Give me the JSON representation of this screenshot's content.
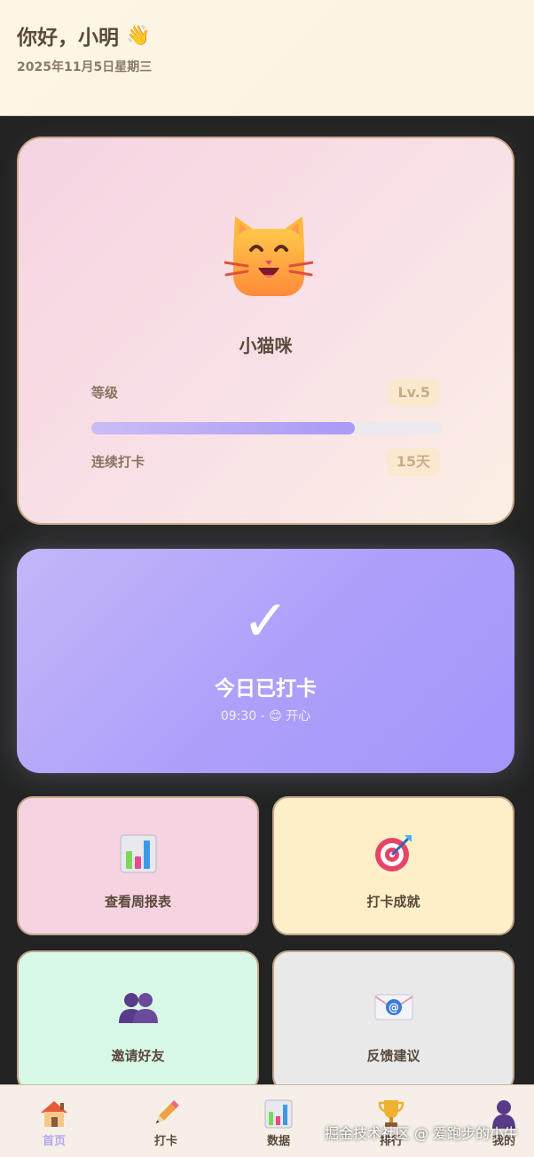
{
  "header": {
    "greeting": "你好，小明",
    "wave_emoji": "👋",
    "date": "2025年11月5日星期三"
  },
  "pet": {
    "icon": "cat-face-icon",
    "name": "小猫咪",
    "level_label": "等级",
    "level_value": "Lv.5",
    "progress": 0.75,
    "streak_label": "连续打卡",
    "streak_value": "15天"
  },
  "checkin": {
    "check_symbol": "✓",
    "title": "今日已打卡",
    "time": "09:30 -",
    "mood_emoji": "😊",
    "mood": "开心"
  },
  "actions": [
    {
      "label": "查看周报表",
      "icon": "bar-chart-icon"
    },
    {
      "label": "打卡成就",
      "icon": "target-icon"
    },
    {
      "label": "邀请好友",
      "icon": "people-icon"
    },
    {
      "label": "反馈建议",
      "icon": "email-icon"
    }
  ],
  "nav": [
    {
      "label": "首页",
      "icon": "house-icon",
      "active": true
    },
    {
      "label": "打卡",
      "icon": "pencil-icon",
      "active": false
    },
    {
      "label": "数据",
      "icon": "bar-chart-icon",
      "active": false
    },
    {
      "label": "排行",
      "icon": "trophy-icon",
      "active": false
    },
    {
      "label": "我的",
      "icon": "person-icon",
      "active": false
    }
  ],
  "watermark": "掘金技术社区 @ 爱跑步的小牛",
  "colors": {
    "accent": "#a99af5",
    "text_primary": "#5a4a3c",
    "header_bg": "#fdf6e6",
    "checkin_bg": "#ad9ffa"
  }
}
